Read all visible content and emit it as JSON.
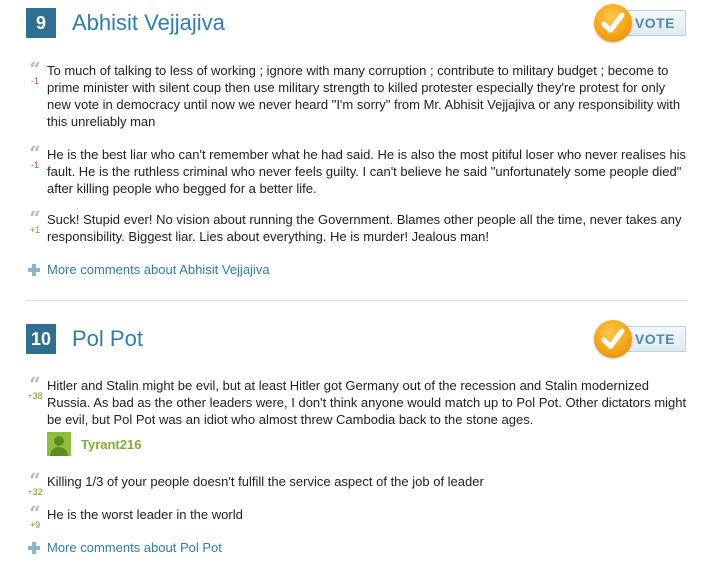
{
  "entries": [
    {
      "rank": "9",
      "name": "Abhisit Vejjajiva",
      "vote_label": "VOTE",
      "comments": [
        {
          "score": "-1",
          "text": "To much of talking to less of working ; ignore with many corruption ; contribute to military budget ; become to prime minister with silent coup then use military strength to killed protester especially they're protest for only new vote in democracy until now we never heard \"I'm sorry\" from Mr. Abhisit Vejjajiva or any responsibility with this unreliably man"
        },
        {
          "score": "-1",
          "text": "He is the best liar who can't remember what he had said. He is also the most pitiful loser who never realises his fault. He is the ruthless criminal who never feels guilty. I can't believe he said \"unfortunately some people died\" after killing people who begged for a better life."
        },
        {
          "score": "+1",
          "text": "Suck! Stupid ever! No vision about running the Government. Blames other people all the time, never takes any responsibility. Biggest liar. Lies about everything. He is murder! Jealous man!"
        }
      ],
      "more_label": "More comments about Abhisit Vejjajiva"
    },
    {
      "rank": "10",
      "name": "Pol Pot",
      "vote_label": "VOTE",
      "comments": [
        {
          "score": "+38",
          "text": "Hitler and Stalin might be evil, but at least Hitler got Germany out of the recession and Stalin modernized Russia. As bad as the other leaders were, I don't think anyone would match up to Pol Pot. Other dictators might be evil, but Pol Pot was an idiot who almost threw Cambodia back to the stone ages.",
          "author": "Tyrant216"
        },
        {
          "score": "+32",
          "text": "Killing 1/3 of your people doesn't fulfill the service aspect of the job of leader"
        },
        {
          "score": "+9",
          "text": "He is the worst leader in the world"
        }
      ],
      "more_label": "More comments about Pol Pot"
    }
  ],
  "icons": {
    "quote": "quote-icon",
    "vote": "checkmark-icon",
    "more": "plus-icon",
    "avatar": "user-avatar"
  },
  "colors": {
    "rank_badge": "#2f6f93",
    "title": "#2e7eae",
    "vote_orange": "#f29a0b",
    "negative": "#d0482b",
    "positive": "#6aa51f",
    "author": "#7fb031"
  }
}
